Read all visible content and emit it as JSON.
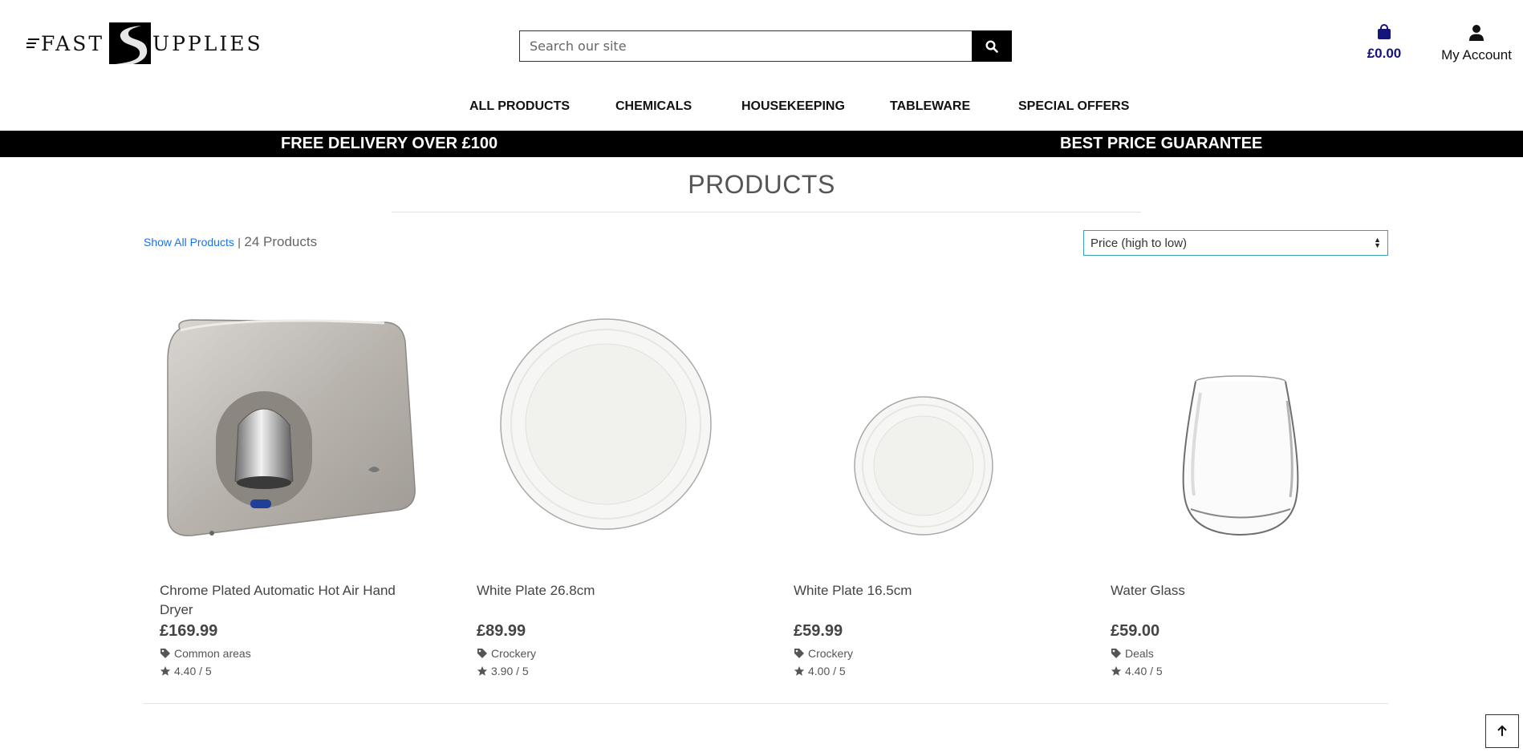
{
  "header": {
    "logo_left": "FAST",
    "logo_right": "UPPLIES",
    "search_placeholder": "Search our site",
    "cart_amount": "£0.00",
    "account_label": "My Account"
  },
  "nav": {
    "items": [
      "ALL PRODUCTS",
      "CHEMICALS",
      "HOUSEKEEPING",
      "TABLEWARE",
      "SPECIAL OFFERS"
    ]
  },
  "promo": {
    "left": "FREE DELIVERY OVER £100",
    "right": "BEST PRICE GUARANTEE"
  },
  "listing": {
    "title": "PRODUCTS",
    "show_all": "Show All Products",
    "separator": "|",
    "count": "24 Products",
    "sort_value": "Price (high to low)"
  },
  "products": [
    {
      "name": "Chrome Plated Automatic Hot Air Hand Dryer",
      "price": "£169.99",
      "category": "Common areas",
      "rating": "4.40 / 5"
    },
    {
      "name": "White Plate 26.8cm",
      "price": "£89.99",
      "category": "Crockery",
      "rating": "3.90 / 5"
    },
    {
      "name": "White Plate 16.5cm",
      "price": "£59.99",
      "category": "Crockery",
      "rating": "4.00 / 5"
    },
    {
      "name": "Water Glass",
      "price": "£59.00",
      "category": "Deals",
      "rating": "4.40 / 5"
    }
  ],
  "icons": {
    "search": "search-icon",
    "cart": "shopping-bag-icon",
    "account": "user-icon",
    "tag": "tag-icon",
    "star": "star-icon",
    "back_to_top": "arrow-up-icon"
  },
  "colors": {
    "cart_amount": "#14147a",
    "link": "#1a73e8",
    "promo_bar": "#000000",
    "select_border": "#3aa0b8"
  }
}
